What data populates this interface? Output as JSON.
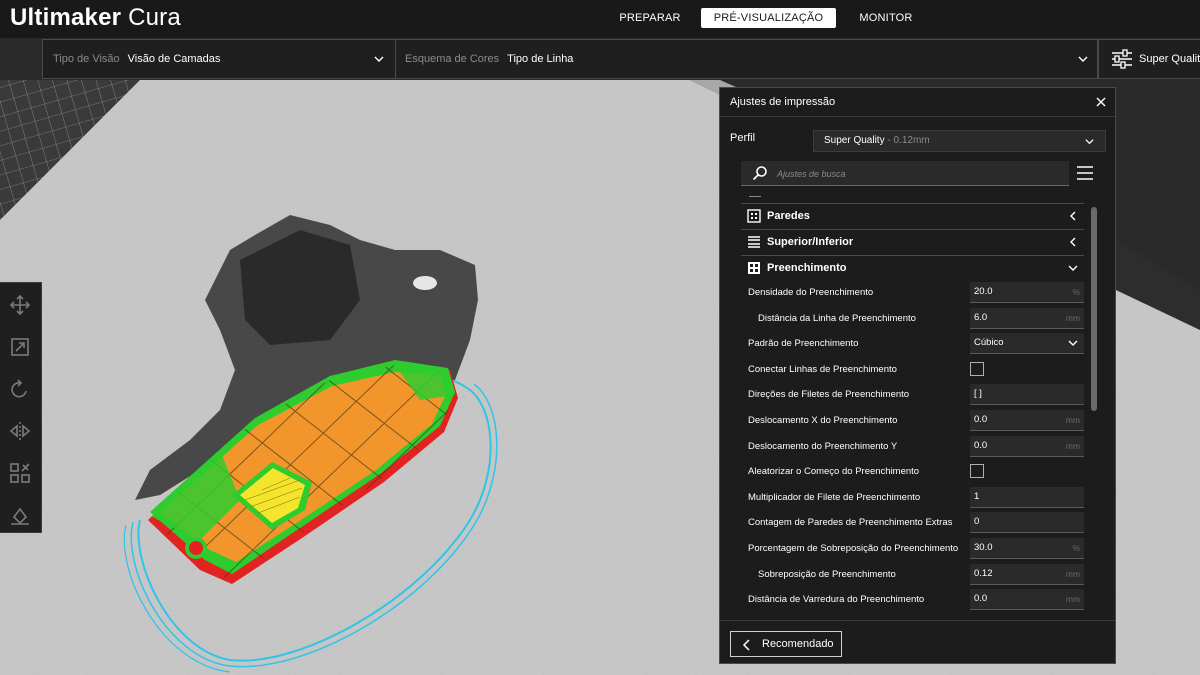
{
  "app": {
    "logo_bold": "Ultimaker",
    "logo_light": "Cura"
  },
  "stages": {
    "prepare": "PREPARAR",
    "preview": "PRÉ-VISUALIZAÇÃO",
    "monitor": "MONITOR"
  },
  "view_bar": {
    "view_type_label": "Tipo de Visão",
    "view_type_value": "Visão de Camadas",
    "color_scheme_label": "Esquema de Cores",
    "color_scheme_value": "Tipo de Linha",
    "quality_label": "Super Quality"
  },
  "toolbar": {
    "tools": [
      "move-tool",
      "scale-tool",
      "rotate-tool",
      "mirror-tool",
      "per-model-settings-tool",
      "support-blocker-tool"
    ]
  },
  "panel": {
    "title": "Ajustes de impressão",
    "profile_label": "Perfil",
    "profile_value": "Super Quality",
    "profile_sub": " - 0.12mm",
    "search_placeholder": "Ajustes de busca",
    "categories": [
      {
        "label": "Paredes",
        "icon": "walls-icon",
        "expanded": false
      },
      {
        "label": "Superior/Inferior",
        "icon": "top-bottom-icon",
        "expanded": false
      },
      {
        "label": "Preenchimento",
        "icon": "infill-icon",
        "expanded": true
      }
    ],
    "settings": [
      {
        "label": "Densidade do Preenchimento",
        "value": "20.0",
        "unit": "%",
        "kind": "field",
        "indent": false
      },
      {
        "label": "Distância da Linha de Preenchimento",
        "value": "6.0",
        "unit": "mm",
        "kind": "field",
        "indent": true
      },
      {
        "label": "Padrão de Preenchimento",
        "value": "Cúbico",
        "unit": "",
        "kind": "select",
        "indent": false
      },
      {
        "label": "Conectar Linhas de Preenchimento",
        "value": "",
        "unit": "",
        "kind": "check",
        "indent": false
      },
      {
        "label": "Direções de Filetes de Preenchimento",
        "value": "[ ]",
        "unit": "",
        "kind": "field",
        "indent": false
      },
      {
        "label": "Deslocamento X do Preenchimento",
        "value": "0.0",
        "unit": "mm",
        "kind": "field",
        "indent": false
      },
      {
        "label": "Deslocamento do Preenchimento Y",
        "value": "0.0",
        "unit": "mm",
        "kind": "field",
        "indent": false
      },
      {
        "label": "Aleatorizar o Começo do Preenchimento",
        "value": "",
        "unit": "",
        "kind": "check",
        "indent": false
      },
      {
        "label": "Multiplicador de Filete de Preenchimento",
        "value": "1",
        "unit": "",
        "kind": "field",
        "indent": false
      },
      {
        "label": "Contagem de Paredes de Preenchimento Extras",
        "value": "0",
        "unit": "",
        "kind": "field",
        "indent": false
      },
      {
        "label": "Porcentagem de Sobreposição do Preenchimento",
        "value": "30.0",
        "unit": "%",
        "kind": "field",
        "indent": false
      },
      {
        "label": "Sobreposição de Preenchimento",
        "value": "0.12",
        "unit": "mm",
        "kind": "field",
        "indent": true
      },
      {
        "label": "Distância de Varredura do Preenchimento",
        "value": "0.0",
        "unit": "mm",
        "kind": "field",
        "indent": false
      }
    ],
    "recommended_label": "Recomendado"
  },
  "colors": {
    "accent": "#ffffff",
    "panel_bg": "#1c1c1c",
    "infill": "#f2962c",
    "skin": "#f4e52c",
    "wall_inner": "#2ecc2e",
    "wall_outer": "#e32222",
    "skirt": "#2fc4e8"
  }
}
